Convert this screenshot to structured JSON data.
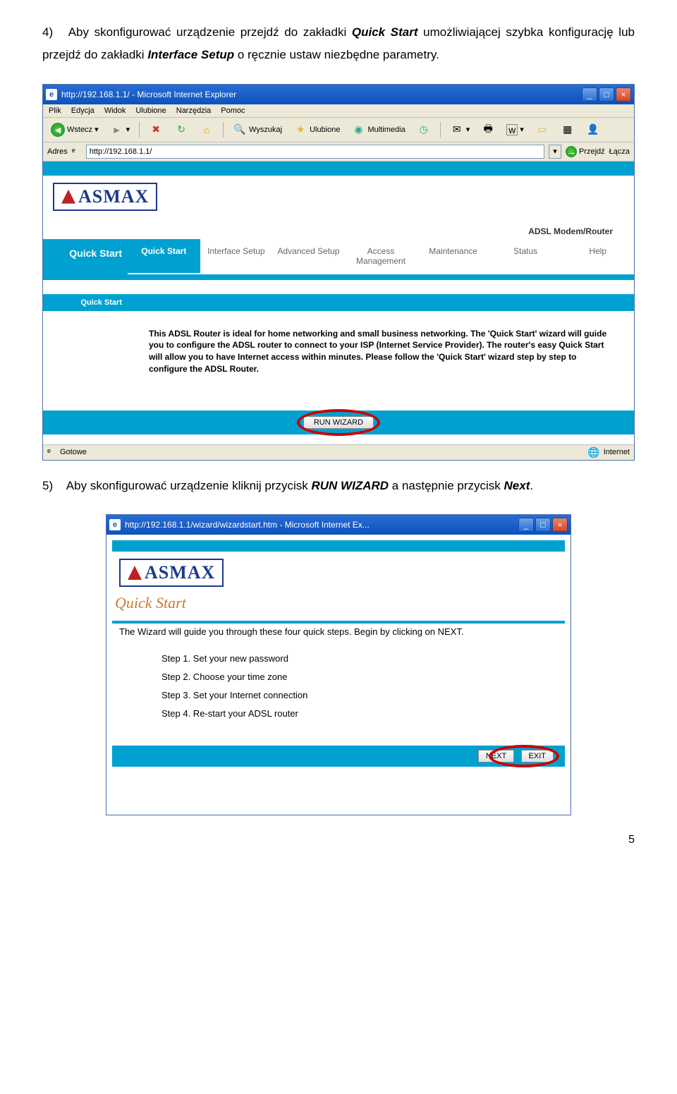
{
  "instr4": {
    "num": "4)",
    "pre": "Aby skonfigurować urządzenie przejdź do zakładki ",
    "q": "Quick Start",
    "mid": " umożliwiającej szybka konfigurację lub przejdź do zakładki ",
    "iset": "Interface Setup",
    "tail": " o ręcznie ustaw niezbędne parametry."
  },
  "instr5": {
    "num": "5)",
    "pre": "Aby skonfigurować urządzenie kliknij przycisk ",
    "run": "RUN WIZARD",
    "mid": " a następnie przycisk ",
    "nxt": "Next",
    "tail": "."
  },
  "ie": {
    "title": "http://192.168.1.1/ - Microsoft Internet Explorer",
    "menu": [
      "Plik",
      "Edycja",
      "Widok",
      "Ulubione",
      "Narzędzia",
      "Pomoc"
    ],
    "back": "Wstecz",
    "search": "Wyszukaj",
    "fav": "Ulubione",
    "media": "Multimedia",
    "addrLabel": "Adres",
    "addr": "http://192.168.1.1/",
    "go": "Przejdź",
    "links": "Łącza",
    "status": "Gotowe",
    "zone": "Internet"
  },
  "router": {
    "logo": "ASMAX",
    "modem": "ADSL Modem/Router",
    "tabs": [
      "Quick Start",
      "Interface Setup",
      "Advanced Setup",
      "Access Management",
      "Maintenance",
      "Status",
      "Help"
    ],
    "side": "Quick Start",
    "sub": "Quick Start",
    "para": "This ADSL Router is ideal for home networking and small business networking. The 'Quick Start' wizard will guide you to configure the ADSL router to connect to your ISP (Internet Service Provider). The router's easy Quick Start will allow you to have Internet access within minutes. Please follow the 'Quick Start' wizard step by step to configure the ADSL Router.",
    "run": "RUN WIZARD"
  },
  "wiz": {
    "title": "http://192.168.1.1/wizard/wizardstart.htm - Microsoft Internet Ex...",
    "logo": "ASMAX",
    "qs": "Quick Start",
    "lead": "The Wizard will guide you through these four quick steps. Begin by clicking on NEXT.",
    "s1": "Step 1. Set your new password",
    "s2": "Step 2. Choose your time zone",
    "s3": "Step 3. Set your Internet connection",
    "s4": "Step 4. Re-start your ADSL router",
    "next": "NEXT",
    "exit": "EXIT"
  },
  "pagenum": "5"
}
